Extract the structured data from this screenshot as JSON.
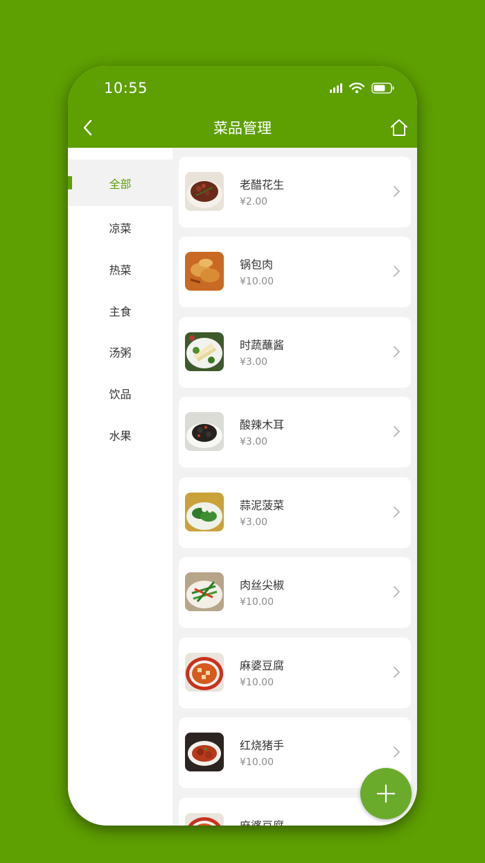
{
  "status_bar": {
    "time": "10:55"
  },
  "header": {
    "title": "菜品管理"
  },
  "categories": [
    {
      "label": "全部",
      "active": true
    },
    {
      "label": "凉菜"
    },
    {
      "label": "热菜"
    },
    {
      "label": "主食"
    },
    {
      "label": "汤粥"
    },
    {
      "label": "饮品"
    },
    {
      "label": "水果"
    }
  ],
  "dishes": [
    {
      "name": "老醋花生",
      "price": "¥2.00"
    },
    {
      "name": "锅包肉",
      "price": "¥10.00"
    },
    {
      "name": "时蔬蘸酱",
      "price": "¥3.00"
    },
    {
      "name": "酸辣木耳",
      "price": "¥3.00"
    },
    {
      "name": "蒜泥菠菜",
      "price": "¥3.00"
    },
    {
      "name": "肉丝尖椒",
      "price": "¥10.00"
    },
    {
      "name": "麻婆豆腐",
      "price": "¥10.00"
    },
    {
      "name": "红烧猪手",
      "price": "¥10.00"
    },
    {
      "name": "麻婆豆腐",
      "price": ""
    }
  ],
  "colors": {
    "accent": "#5e9f02",
    "fab": "#6aab2c",
    "list_bg": "#f2f2f2"
  },
  "icons": {
    "back": "chevron-left-icon",
    "home": "home-icon",
    "fab": "plus-icon",
    "row": "chevron-right-icon"
  }
}
